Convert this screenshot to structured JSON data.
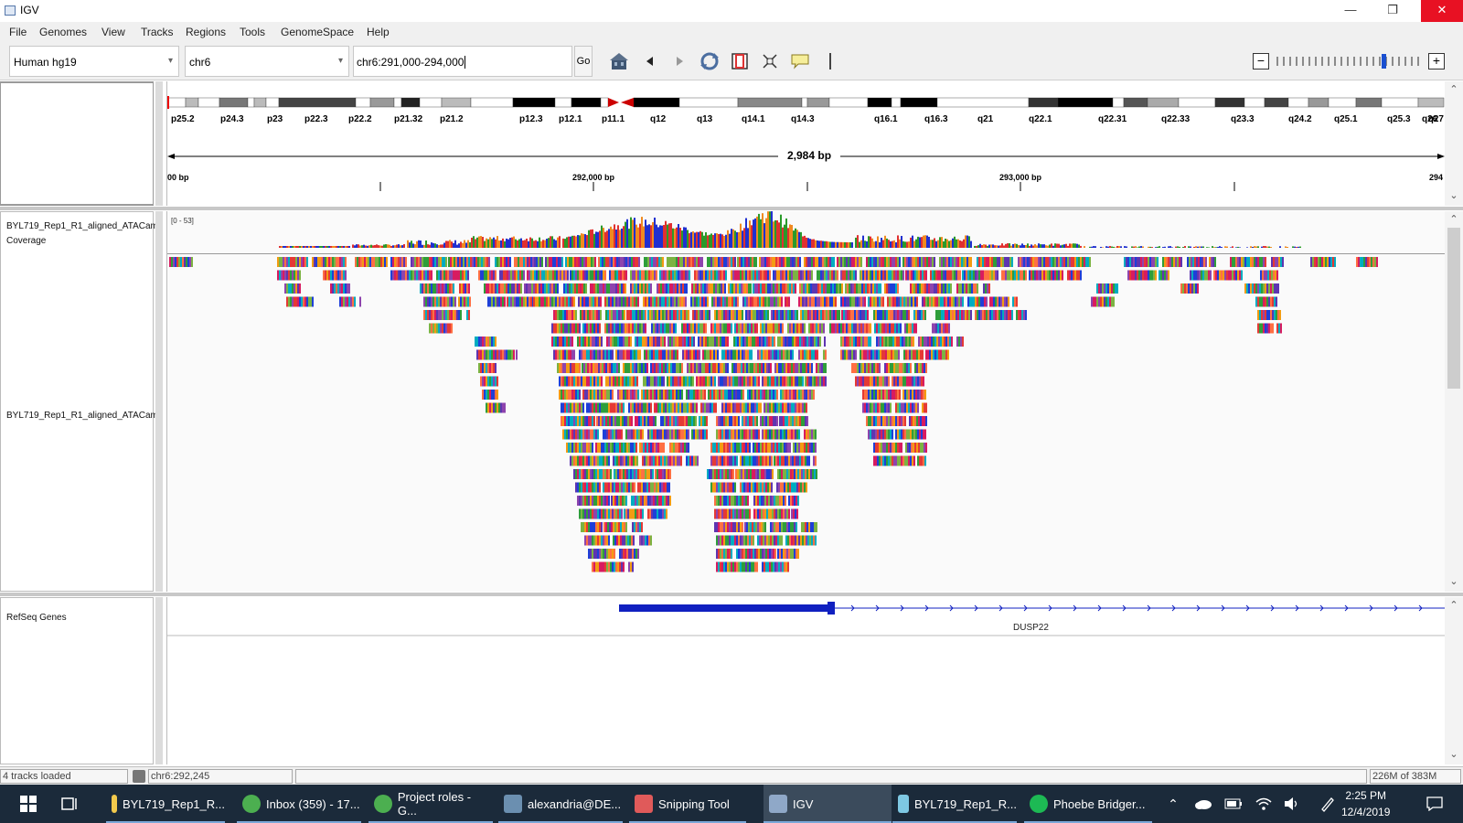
{
  "window": {
    "title": "IGV",
    "minimize": "—",
    "restore": "❐",
    "close": "✕"
  },
  "menu": [
    "File",
    "Genomes",
    "View",
    "Tracks",
    "Regions",
    "Tools",
    "GenomeSpace",
    "Help"
  ],
  "toolbar": {
    "genome": "Human hg19",
    "chromosome": "chr6",
    "locus": "chr6:291,000-294,000",
    "go_label": "Go",
    "zoom_minus": "−",
    "zoom_plus": "+"
  },
  "ideogram": {
    "bands": [
      "p25.2",
      "p24.3",
      "p23",
      "p22.3",
      "p22.2",
      "p21.32",
      "p21.2",
      "p12.3",
      "p12.1",
      "p11.1",
      "q12",
      "q13",
      "q14.1",
      "q14.3",
      "q16.1",
      "q16.3",
      "q21",
      "q22.1",
      "q22.31",
      "q22.33",
      "q23.3",
      "q24.2",
      "q25.1",
      "q25.3",
      "q26",
      "q27"
    ]
  },
  "ruler": {
    "span": "2,984 bp",
    "left_label": "00 bp",
    "tick_1": "292,000 bp",
    "tick_2": "293,000 bp",
    "right_label": "294"
  },
  "tracks": {
    "coverage_name": "BYL719_Rep1_R1_aligned_ATACam Coverage",
    "coverage_range": "[0 - 53]",
    "alignment_name": "BYL719_Rep1_R1_aligned_ATACam",
    "refseq_name": "RefSeq Genes",
    "gene_name": "DUSP22"
  },
  "status": {
    "tracks_loaded": "4 tracks loaded",
    "position": "chr6:292,245",
    "message": "",
    "memory": "226M of 383M"
  },
  "taskbar": {
    "items": [
      {
        "label": "BYL719_Rep1_R...",
        "icon": "folder-icon",
        "color": "#f2c94c"
      },
      {
        "label": "Inbox (359) - 17...",
        "icon": "chrome-icon",
        "color": "#4caf50"
      },
      {
        "label": "Project roles - G...",
        "icon": "chrome-icon",
        "color": "#4caf50"
      },
      {
        "label": "alexandria@DE...",
        "icon": "terminal-icon",
        "color": "#6b8fb0"
      },
      {
        "label": "Snipping Tool",
        "icon": "scissors-icon",
        "color": "#e05a5a"
      },
      {
        "label": "IGV",
        "icon": "igv-icon",
        "color": "#8fa8c8"
      },
      {
        "label": "BYL719_Rep1_R...",
        "icon": "notepad-icon",
        "color": "#7ec8e3"
      },
      {
        "label": "Phoebe Bridger...",
        "icon": "spotify-icon",
        "color": "#1db954"
      }
    ],
    "time": "2:25 PM",
    "date": "12/4/2019"
  },
  "colors": {
    "window_bg": "#f0f0f0",
    "close_red": "#e81123",
    "gene_blue": "#1020c0",
    "taskbar_bg": "#1b2a3a",
    "centromere_red": "#cc0000"
  }
}
